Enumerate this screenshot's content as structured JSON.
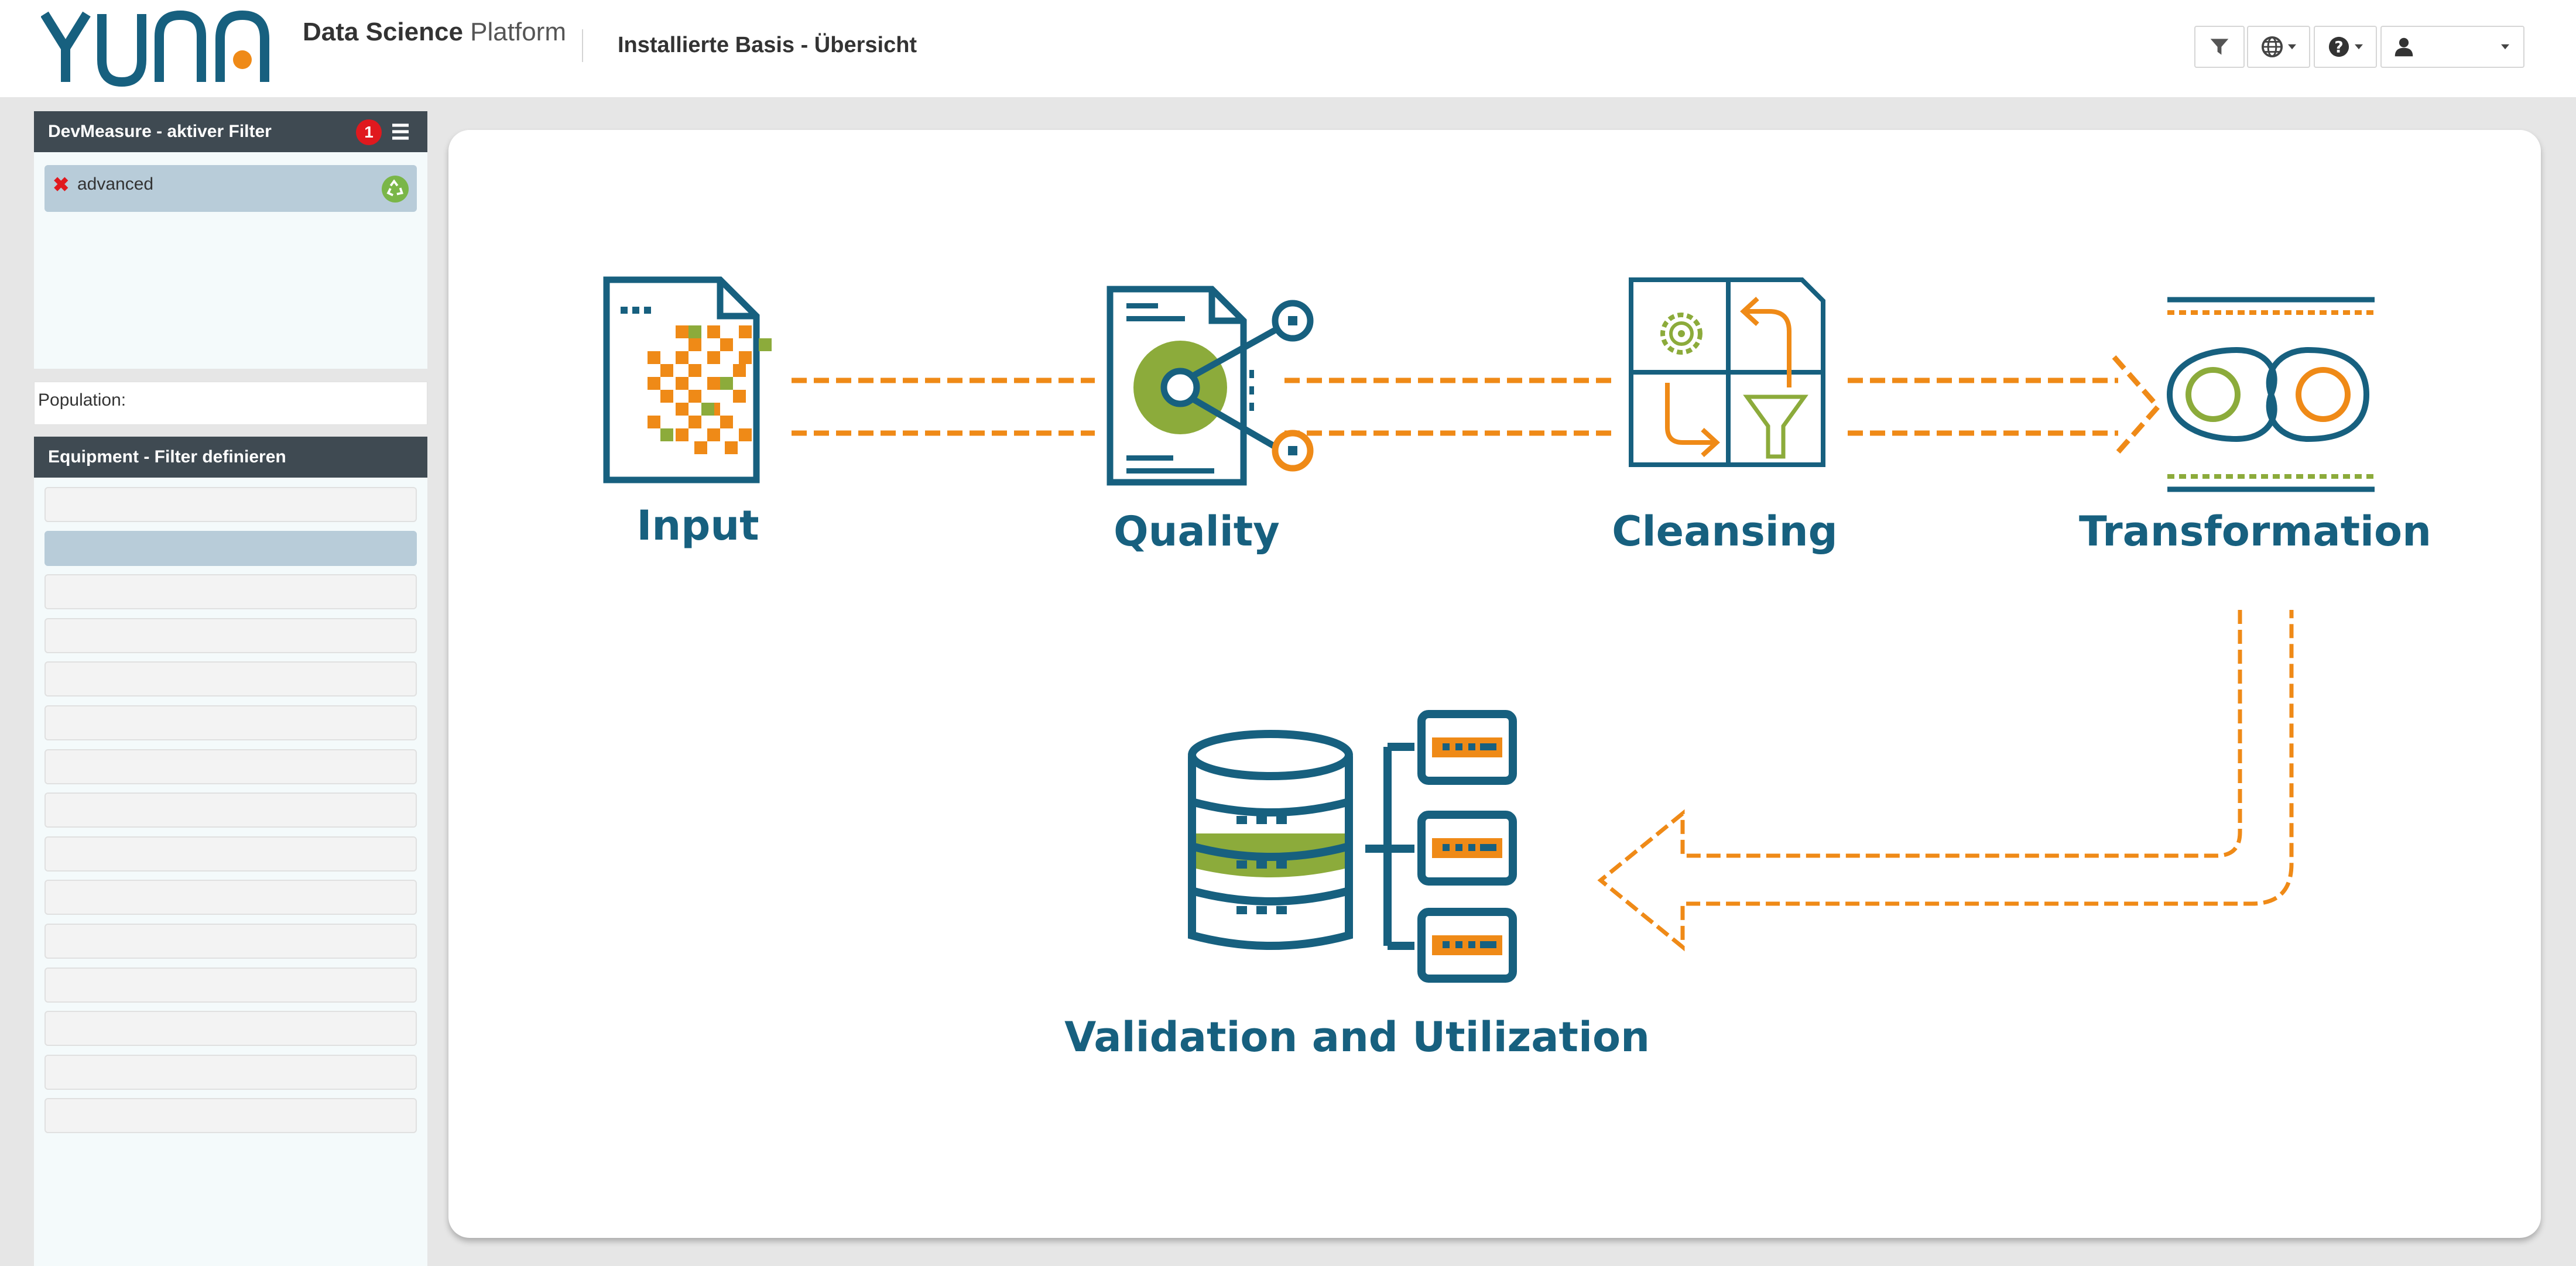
{
  "header": {
    "logo_text": "YUNA",
    "brand_bold": "Data Science",
    "brand_light": "Platform",
    "page_title": "Installierte Basis - Übersicht",
    "buttons": [
      {
        "icon": "filter-icon"
      },
      {
        "icon": "globe-icon"
      },
      {
        "icon": "question-icon"
      },
      {
        "icon": "user-icon"
      }
    ]
  },
  "sidebar": {
    "active_filter": {
      "title": "DevMeasure - aktiver Filter",
      "badge_count": "1",
      "filters": [
        {
          "label": "advanced"
        }
      ]
    },
    "population": {
      "label": "Population:"
    },
    "equipment": {
      "title": "Equipment - Filter definieren",
      "row_count": 15,
      "selected_index": 1
    }
  },
  "diagram": {
    "steps": [
      {
        "label": "Input"
      },
      {
        "label": "Quality"
      },
      {
        "label": "Cleansing"
      },
      {
        "label": "Transformation"
      },
      {
        "label": "Validation and Utilization"
      }
    ],
    "colors": {
      "blue": "#17607f",
      "orange": "#ef8a17",
      "green": "#8cab3b"
    }
  },
  "colors": {
    "panel_header": "#3f4a52",
    "panel_body": "#f4fafb",
    "selected": "#b8ccd9",
    "badge": "#e0191e"
  }
}
